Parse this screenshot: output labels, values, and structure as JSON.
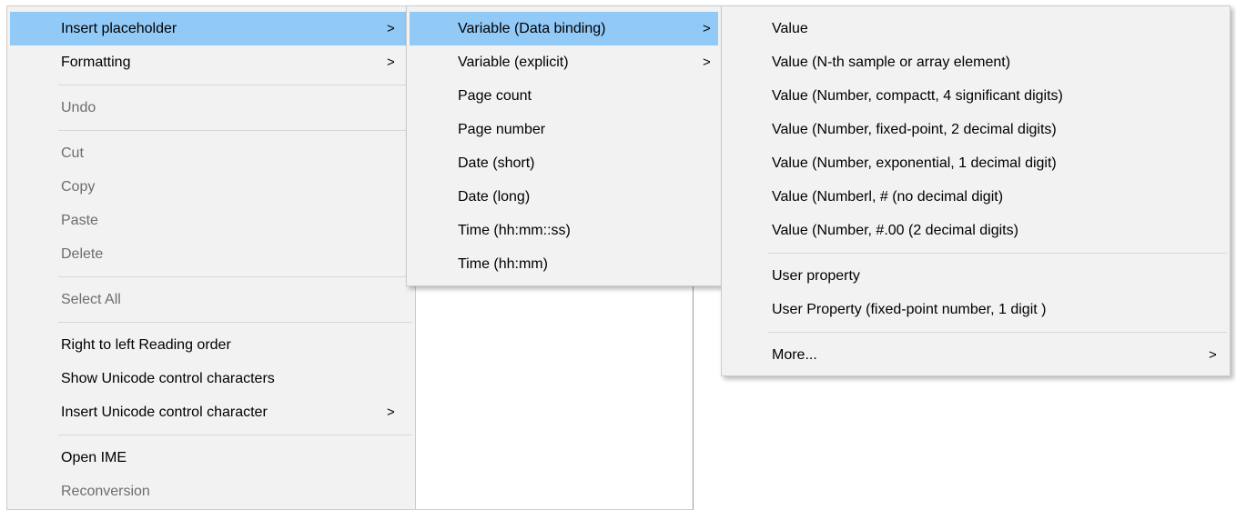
{
  "menu1": {
    "insert_placeholder": "Insert placeholder",
    "formatting": "Formatting",
    "undo": "Undo",
    "cut": "Cut",
    "copy": "Copy",
    "paste": "Paste",
    "delete": "Delete",
    "select_all": "Select All",
    "rtl_reading_order": "Right to left Reading order",
    "show_unicode_control": "Show Unicode control characters",
    "insert_unicode_control": "Insert Unicode control character",
    "open_ime": "Open IME",
    "reconversion": "Reconversion"
  },
  "menu2": {
    "variable_data_binding": "Variable (Data binding)",
    "variable_explicit": "Variable (explicit)",
    "page_count": "Page count",
    "page_number": "Page number",
    "date_short": "Date (short)",
    "date_long": "Date (long)",
    "time_hhmmss": "Time (hh:mm::ss)",
    "time_hhmm": "Time (hh:mm)"
  },
  "menu3": {
    "value": "Value",
    "value_nth": "Value (N-th sample or array element)",
    "value_compact": "Value (Number, compactt, 4 significant digits)",
    "value_fixed": "Value (Number, fixed-point, 2 decimal digits)",
    "value_exponential": "Value (Number, exponential, 1 decimal digit)",
    "value_no_decimal": "Value (Numberl, # (no decimal digit)",
    "value_two_decimal": "Value (Number, #.00 (2 decimal digits)",
    "user_property": "User property",
    "user_property_fixed": "User Property (fixed-point number, 1 digit )",
    "more": "More..."
  },
  "glyphs": {
    "submenu_arrow": ">"
  },
  "colors": {
    "menu_bg": "#f2f2f2",
    "highlight": "#91c9f7",
    "disabled_text": "#6d6d6d"
  }
}
